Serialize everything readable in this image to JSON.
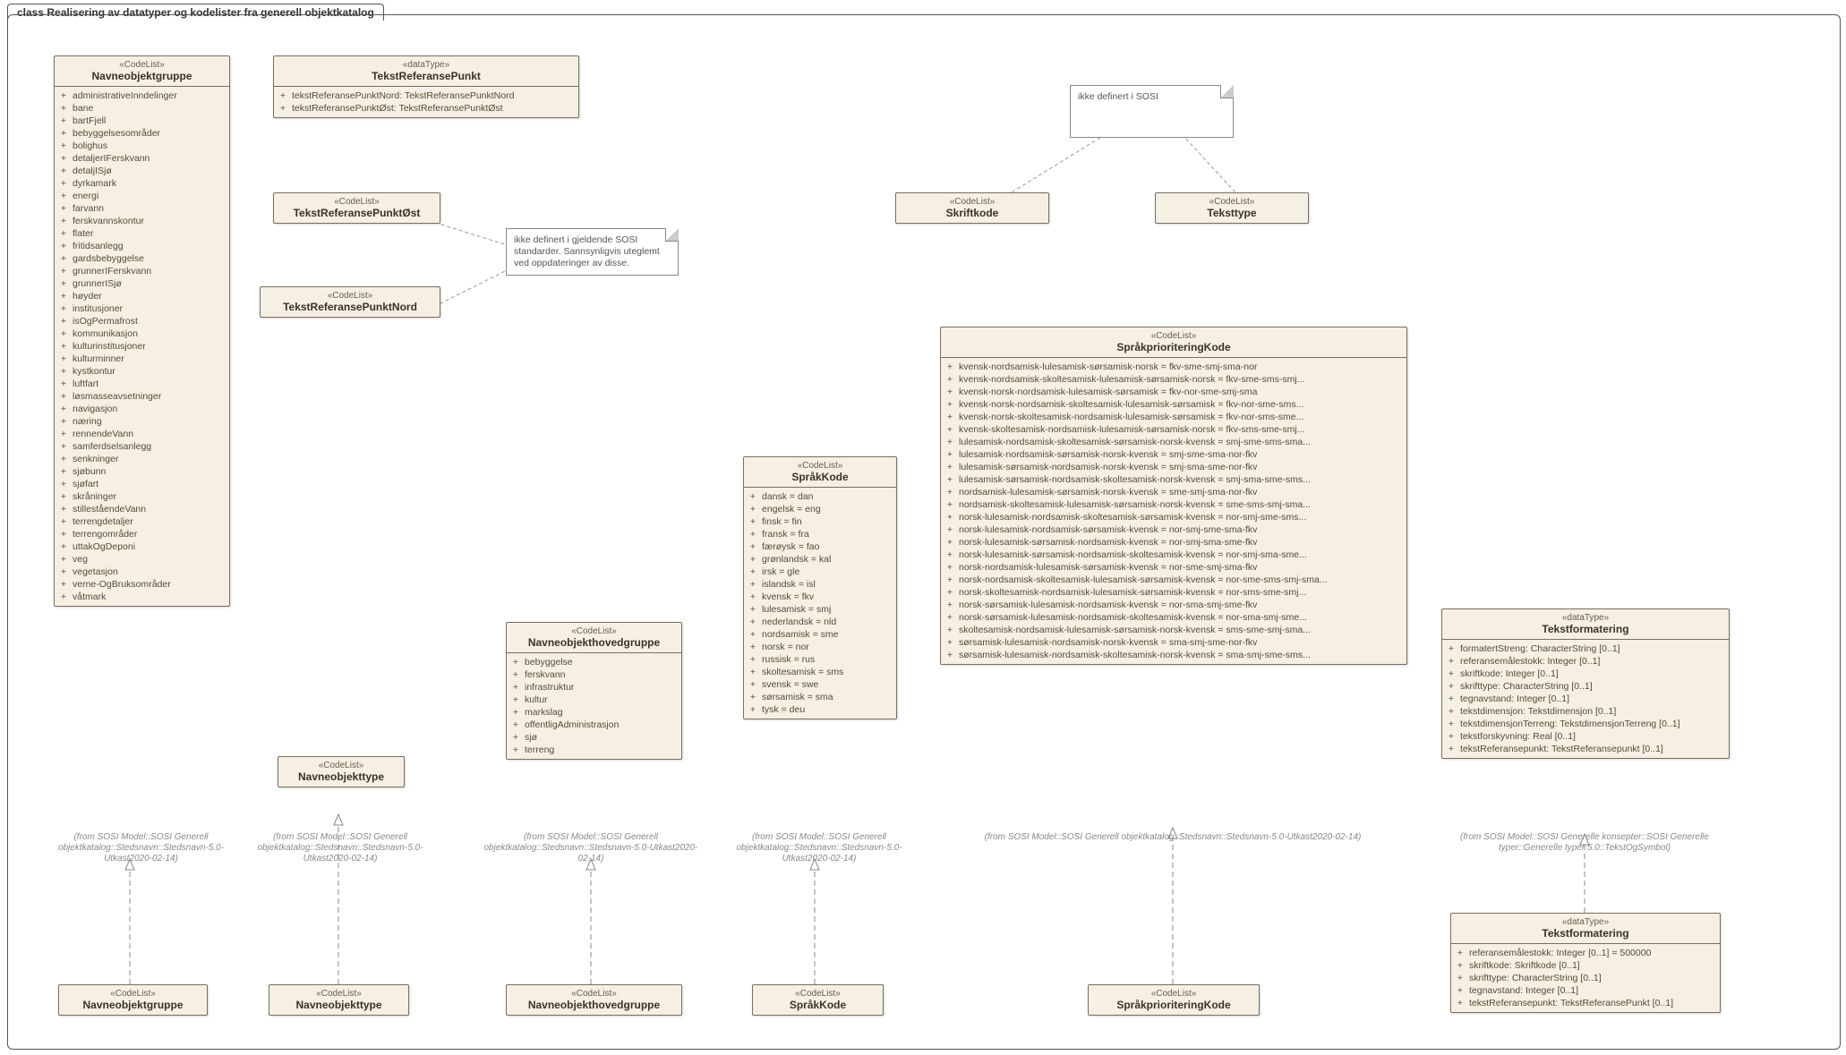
{
  "frame_title": "class Realisering av datatyper og kodelister fra generell objektkatalog",
  "from_sosi": "(from SOSI Model::SOSI Generell objektkatalog::Stedsnavn::Stedsnavn-5.0-Utkast2020-02-14)",
  "from_sosi_long": "(from SOSI Model::SOSI Generell objektkatalog::Stedsnavn::Stedsnavn-5.0-Utkast2020-02-14)",
  "from_sosi_typer": "(from SOSI Model::SOSI Generelle konsepter::SOSI Generelle typer::Generelle typer 5.0::TekstOgSymbol)",
  "note1": "ikke definert i gjeldende SOSI standarder. Sannsynligvis uteglemt ved oppdateringer av disse.",
  "note2": "ikke definert i SOSI",
  "navneobjektgruppe": {
    "stereotype": "«CodeList»",
    "name": "Navneobjektgruppe",
    "attrs": [
      "administrativeInndelinger",
      "bane",
      "bartFjell",
      "bebyggelsesområder",
      "bolighus",
      "detaljerIFerskvann",
      "detaljISjø",
      "dyrkamark",
      "energi",
      "farvann",
      "ferskvannskontur",
      "flater",
      "fritidsanlegg",
      "gardsbebyggelse",
      "grunnerIFerskvann",
      "grunnerISjø",
      "høyder",
      "institusjoner",
      "isOgPermafrost",
      "kommunikasjon",
      "kulturinstitusjoner",
      "kulturminner",
      "kystkontur",
      "luftfart",
      "løsmasseavsetninger",
      "navigasjon",
      "næring",
      "rennendeVann",
      "samferdselsanlegg",
      "senkninger",
      "sjøbunn",
      "sjøfart",
      "skråninger",
      "stilleståendeVann",
      "terrengdetaljer",
      "terrengområder",
      "uttakOgDeponi",
      "veg",
      "vegetasjon",
      "verne-OgBruksområder",
      "våtmark"
    ]
  },
  "tekstreferansepunkt": {
    "stereotype": "«dataType»",
    "name": "TekstReferansePunkt",
    "attrs": [
      "tekstReferansePunktNord: TekstReferansePunktNord",
      "tekstReferansePunktØst: TekstReferansePunktØst"
    ]
  },
  "trp_ost": {
    "stereotype": "«CodeList»",
    "name": "TekstReferansePunktØst"
  },
  "trp_nord": {
    "stereotype": "«CodeList»",
    "name": "TekstReferansePunktNord"
  },
  "skriftkode": {
    "stereotype": "«CodeList»",
    "name": "Skriftkode"
  },
  "teksttype": {
    "stereotype": "«CodeList»",
    "name": "Teksttype"
  },
  "navneobjekttype": {
    "stereotype": "«CodeList»",
    "name": "Navneobjekttype"
  },
  "navneobjekttype_sub": {
    "stereotype": "«CodeList»",
    "name": "Navneobjekttype"
  },
  "navneobjektgruppe_sub": {
    "stereotype": "«CodeList»",
    "name": "Navneobjektgruppe"
  },
  "navneobjekthovedgruppe": {
    "stereotype": "«CodeList»",
    "name": "Navneobjekthovedgruppe",
    "attrs": [
      "bebyggelse",
      "ferskvann",
      "infrastruktur",
      "kultur",
      "markslag",
      "offentligAdministrasjon",
      "sjø",
      "terreng"
    ]
  },
  "navneobjekthovedgruppe_sub": {
    "stereotype": "«CodeList»",
    "name": "Navneobjekthovedgruppe"
  },
  "sprakkode": {
    "stereotype": "«CodeList»",
    "name": "SpråkKode",
    "attrs": [
      "dansk = dan",
      "engelsk = eng",
      "finsk = fin",
      "fransk = fra",
      "færøysk = fao",
      "grønlandsk = kal",
      "irsk = gle",
      "islandsk = isl",
      "kvensk = fkv",
      "lulesamisk = smj",
      "nederlandsk = nld",
      "nordsamisk = sme",
      "norsk = nor",
      "russisk = rus",
      "skoltesamisk = sms",
      "svensk = swe",
      "sørsamisk = sma",
      "tysk = deu"
    ]
  },
  "sprakkode_sub": {
    "stereotype": "«CodeList»",
    "name": "SpråkKode"
  },
  "sprakprioritering": {
    "stereotype": "«CodeList»",
    "name": "SpråkprioriteringKode",
    "attrs": [
      "kvensk-nordsamisk-lulesamisk-sørsamisk-norsk = fkv-sme-smj-sma-nor",
      "kvensk-nordsamisk-skoltesamisk-lulesamisk-sørsamisk-norsk = fkv-sme-sms-smj...",
      "kvensk-norsk-nordsamisk-lulesamisk-sørsamisk = fkv-nor-sme-smj-sma",
      "kvensk-norsk-nordsamisk-skoltesamisk-lulesamisk-sørsamisk = fkv-nor-sme-sms...",
      "kvensk-norsk-skoltesamisk-nordsamisk-lulesamisk-sørsamisk = fkv-nor-sms-sme...",
      "kvensk-skoltesamisk-nordsamisk-lulesamisk-sørsamisk-norsk = fkv-sms-sme-smj...",
      "lulesamisk-nordsamisk-skoltesamisk-sørsamisk-norsk-kvensk = smj-sme-sms-sma...",
      "lulesamisk-nordsamisk-sørsamisk-norsk-kvensk = smj-sme-sma-nor-fkv",
      "lulesamisk-sørsamisk-nordsamisk-norsk-kvensk = smj-sma-sme-nor-fkv",
      "lulesamisk-sørsamisk-nordsamisk-skoltesamisk-norsk-kvensk = smj-sma-sme-sms...",
      "nordsamisk-lulesamisk-sørsamisk-norsk-kvensk = sme-smj-sma-nor-fkv",
      "nordsamisk-skoltesamisk-lulesamisk-sørsamisk-norsk-kvensk = sme-sms-smj-sma...",
      "norsk-lulesamisk-nordsamisk-skoltesamisk-sørsamisk-kvensk = nor-smj-sme-sms...",
      "norsk-lulesamisk-nordsamisk-sørsamisk-kvensk = nor-smj-sme-sma-fkv",
      "norsk-lulesamisk-sørsamisk-nordsamisk-kvensk = nor-smj-sma-sme-fkv",
      "norsk-lulesamisk-sørsamisk-nordsamisk-skoltesamisk-kvensk = nor-smj-sma-sme...",
      "norsk-nordsamisk-lulesamisk-sørsamisk-kvensk = nor-sme-smj-sma-fkv",
      "norsk-nordsamisk-skoltesamisk-lulesamisk-sørsamisk-kvensk = nor-sme-sms-smj-sma...",
      "norsk-skoltesamisk-nordsamisk-lulesamisk-sørsamisk-kvensk = nor-sms-sme-smj...",
      "norsk-sørsamisk-lulesamisk-nordsamisk-kvensk = nor-sma-smj-sme-fkv",
      "norsk-sørsamisk-lulesamisk-nordsamisk-skoltesamisk-kvensk = nor-sma-smj-sme...",
      "skoltesamisk-nordsamisk-lulesamisk-sørsamisk-norsk-kvensk = sms-sme-smj-sma...",
      "sørsamisk-lulesamisk-nordsamisk-norsk-kvensk = sma-smj-sme-nor-fkv",
      "sørsamisk-lulesamisk-nordsamisk-skoltesamisk-norsk-kvensk = sma-smj-sme-sms..."
    ]
  },
  "sprakprioritering_sub": {
    "stereotype": "«CodeList»",
    "name": "SpråkprioriteringKode"
  },
  "tekstformatering": {
    "stereotype": "«dataType»",
    "name": "Tekstformatering",
    "attrs": [
      "formatertStreng: CharacterString [0..1]",
      "referansemålestokk: Integer [0..1]",
      "skriftkode: Integer [0..1]",
      "skrifttype: CharacterString [0..1]",
      "tegnavstand: Integer [0..1]",
      "tekstdimensjon: Tekstdimensjon [0..1]",
      "tekstdimensjonTerreng: TekstdimensjonTerreng [0..1]",
      "tekstforskyvning: Real [0..1]",
      "tekstReferansepunkt: TekstReferansepunkt [0..1]"
    ]
  },
  "tekstformatering2": {
    "stereotype": "«dataType»",
    "name": "Tekstformatering",
    "attrs": [
      "referansemålestokk: Integer [0..1] = 500000",
      "skriftkode: Skriftkode [0..1]",
      "skrifttype: CharacterString [0..1]",
      "tegnavstand: Integer [0..1]",
      "tekstReferansepunkt: TekstReferansePunkt [0..1]"
    ]
  }
}
